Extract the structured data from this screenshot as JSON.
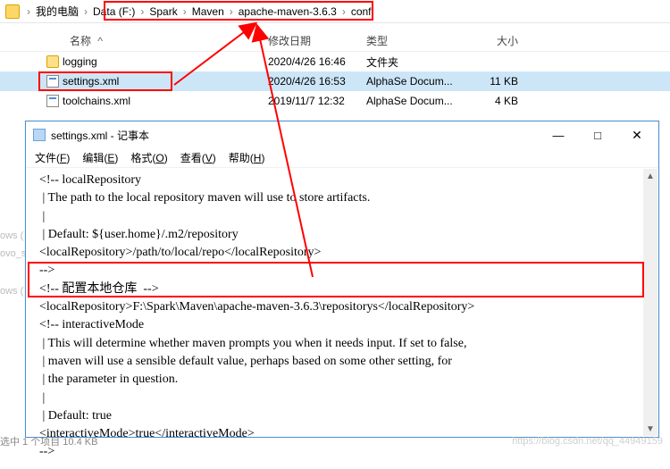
{
  "explorer": {
    "breadcrumb": {
      "root": "我的电脑",
      "items": [
        "Data (F:)",
        "Spark",
        "Maven",
        "apache-maven-3.6.3",
        "conf"
      ]
    },
    "headers": {
      "name": "名称",
      "date": "修改日期",
      "type": "类型",
      "size": "大小",
      "sort_indicator": "^"
    },
    "rows": [
      {
        "icon": "folder",
        "name": "logging",
        "date": "2020/4/26 16:46",
        "type": "文件夹",
        "size": ""
      },
      {
        "icon": "xml",
        "name": "settings.xml",
        "date": "2020/4/26 16:53",
        "type": "AlphaSe Docum...",
        "size": "11 KB",
        "selected": true
      },
      {
        "icon": "xml",
        "name": "toolchains.xml",
        "date": "2019/11/7 12:32",
        "type": "AlphaSe Docum...",
        "size": "4 KB"
      }
    ]
  },
  "notepad": {
    "title": "settings.xml - 记事本",
    "menus": {
      "file": {
        "label": "文件",
        "accel": "F"
      },
      "edit": {
        "label": "编辑",
        "accel": "E"
      },
      "format": {
        "label": "格式",
        "accel": "O"
      },
      "view": {
        "label": "查看",
        "accel": "V"
      },
      "help": {
        "label": "帮助",
        "accel": "H"
      }
    },
    "win_btns": {
      "min": "—",
      "max": "□",
      "close": "✕"
    },
    "lines": [
      "  <!-- localRepository",
      "   | The path to the local repository maven will use to store artifacts.",
      "   |",
      "   | Default: ${user.home}/.m2/repository",
      "  <localRepository>/path/to/local/repo</localRepository>",
      "  -->",
      "",
      "  <!-- 配置本地仓库  -->",
      "  <localRepository>F:\\Spark\\Maven\\apache-maven-3.6.3\\repositorys</localRepository>",
      "  <!-- interactiveMode",
      "   | This will determine whether maven prompts you when it needs input. If set to false,",
      "   | maven will use a sensible default value, perhaps based on some other setting, for",
      "   | the parameter in question.",
      "   |",
      "   | Default: true",
      "  <interactiveMode>true</interactiveMode>",
      "  -->"
    ]
  },
  "left_occluded": {
    "a": "ows (",
    "b": "ovo_s",
    "c": "",
    "d": "ows ("
  },
  "watermark": "https://blog.csdn.net/qq_44949159",
  "status_occluded": "选中 1 个项目  10.4 KB"
}
